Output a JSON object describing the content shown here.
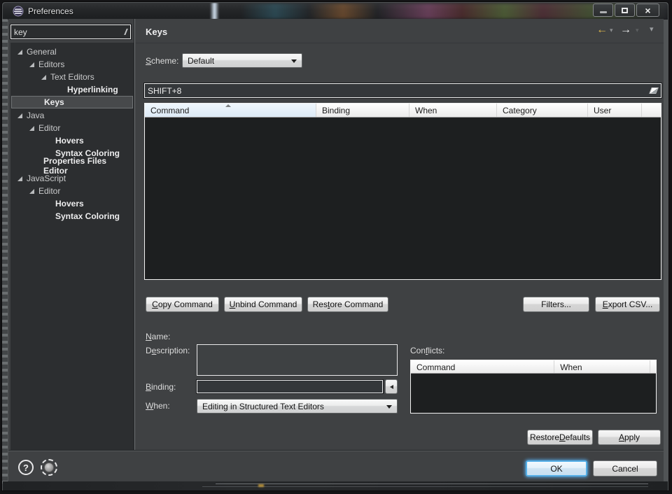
{
  "window": {
    "title": "Preferences",
    "icon": "eclipse-logo",
    "controls": {
      "minimize": "minimize-icon",
      "maximize": "maximize-icon",
      "close": "close-icon"
    }
  },
  "icons": {
    "back_arrow": "←",
    "forward_arrow": "→",
    "dropdown_chevron": "▾",
    "help": "?",
    "close": "×"
  },
  "sidebar": {
    "filter": {
      "value": "key"
    },
    "tree": [
      {
        "label": "General",
        "depth": 0,
        "expanded": true,
        "match": false,
        "selected": false
      },
      {
        "label": "Editors",
        "depth": 1,
        "expanded": true,
        "match": false,
        "selected": false
      },
      {
        "label": "Text Editors",
        "depth": 2,
        "expanded": true,
        "match": false,
        "selected": false
      },
      {
        "label": "Hyperlinking",
        "depth": 3,
        "expanded": false,
        "match": true,
        "selected": false
      },
      {
        "label": "Keys",
        "depth": 1,
        "expanded": false,
        "match": true,
        "selected": true
      },
      {
        "label": "Java",
        "depth": 0,
        "expanded": true,
        "match": false,
        "selected": false
      },
      {
        "label": "Editor",
        "depth": 1,
        "expanded": true,
        "match": false,
        "selected": false
      },
      {
        "label": "Hovers",
        "depth": 2,
        "expanded": false,
        "match": true,
        "selected": false
      },
      {
        "label": "Syntax Coloring",
        "depth": 2,
        "expanded": false,
        "match": true,
        "selected": false
      },
      {
        "label": "Properties Files Editor",
        "depth": 1,
        "expanded": false,
        "match": true,
        "selected": false
      },
      {
        "label": "JavaScript",
        "depth": 0,
        "expanded": true,
        "match": false,
        "selected": false
      },
      {
        "label": "Editor",
        "depth": 1,
        "expanded": true,
        "match": false,
        "selected": false
      },
      {
        "label": "Hovers",
        "depth": 2,
        "expanded": false,
        "match": true,
        "selected": false
      },
      {
        "label": "Syntax Coloring",
        "depth": 2,
        "expanded": false,
        "match": true,
        "selected": false
      }
    ]
  },
  "page": {
    "title": "Keys",
    "scheme_label": {
      "m": "S",
      "post": "cheme:"
    },
    "scheme_value": "Default",
    "search_value": "SHIFT+8",
    "bindings_table": {
      "columns": [
        "Command",
        "Binding",
        "When",
        "Category",
        "User"
      ],
      "sorted_column": "Command",
      "sort_direction": "ascending",
      "rows": []
    },
    "actions": {
      "copy": {
        "m": "C",
        "post": "opy Command"
      },
      "unbind": {
        "m": "U",
        "post": "nbind Command"
      },
      "restore": {
        "pre": "Res",
        "m": "t",
        "post": "ore Command"
      },
      "filters": "Filters...",
      "export": {
        "m": "E",
        "post": "xport CSV..."
      }
    },
    "details": {
      "name_label": {
        "m": "N",
        "post": "ame:"
      },
      "name_value": "",
      "description_label": {
        "pre": "D",
        "m": "e",
        "post": "scription:"
      },
      "description_value": "",
      "binding_label": {
        "m": "B",
        "post": "inding:"
      },
      "binding_value": "",
      "when_label": {
        "m": "W",
        "post": "hen:"
      },
      "when_value": "Editing in Structured Text Editors"
    },
    "conflicts": {
      "label": {
        "pre": "Con",
        "m": "f",
        "post": "licts:"
      },
      "columns": [
        "Command",
        "When"
      ],
      "rows": []
    },
    "footer_buttons": {
      "restore_defaults": {
        "pre": "Restore ",
        "m": "D",
        "post": "efaults"
      },
      "apply": {
        "m": "A",
        "post": "pply"
      }
    }
  },
  "dialog_buttons": {
    "ok": "OK",
    "cancel": "Cancel"
  },
  "colors": {
    "back_arrow_accent": "#d9b44a",
    "forward_arrow": "#f0f1f2",
    "default_button_glow": "#54aee6",
    "selection_border": "#707375",
    "table_body_bg": "#1d1f20"
  }
}
